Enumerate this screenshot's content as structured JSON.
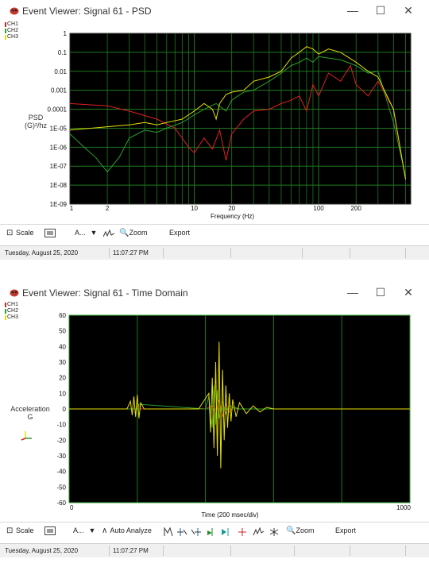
{
  "psd_window": {
    "title": "Event Viewer: Signal  61  - PSD",
    "controls": {
      "minimize": "—",
      "maximize": "☐",
      "close": "✕"
    },
    "legend": [
      {
        "label": "CH1",
        "color": "#e02020"
      },
      {
        "label": "CH2",
        "color": "#2aa02a"
      },
      {
        "label": "CH3",
        "color": "#e8e000"
      }
    ],
    "ylabel_line1": "PSD",
    "ylabel_line2": "(G)²/hz",
    "xlabel": "Frequency (Hz)",
    "toolbar": {
      "scale": "Scale",
      "a_menu": "A...",
      "zoom": "Zoom",
      "export": "Export"
    },
    "status": {
      "date": "Tuesday, August 25, 2020",
      "time": "11:07:27 PM"
    }
  },
  "time_window": {
    "title": "Event Viewer: Signal  61  - Time Domain",
    "controls": {
      "minimize": "—",
      "maximize": "☐",
      "close": "✕"
    },
    "legend": [
      {
        "label": "CH1",
        "color": "#e02020"
      },
      {
        "label": "CH2",
        "color": "#2aa02a"
      },
      {
        "label": "CH3",
        "color": "#e8e000"
      }
    ],
    "ylabel_line1": "Acceleration",
    "ylabel_line2": "G",
    "xlabel": "Time (200 msec/div)",
    "toolbar": {
      "scale": "Scale",
      "a_menu": "A...",
      "auto_analyze": "Auto Analyze",
      "zoom": "Zoom",
      "export": "Export"
    },
    "status": {
      "date": "Tuesday, August 25, 2020",
      "time": "11:07:27 PM"
    }
  },
  "chart_data": [
    {
      "type": "line",
      "xlabel": "Frequency (Hz)",
      "ylabel": "PSD (G)²/hz",
      "x_scale": "log",
      "y_scale": "log",
      "xlim": [
        1,
        550
      ],
      "ylim": [
        1e-09,
        1
      ],
      "grid": true,
      "legend_position": "top-left",
      "x_tick_labels": [
        "1",
        "2",
        "10",
        "20",
        "100",
        "200"
      ],
      "y_tick_labels": [
        "1E-09",
        "1E-08",
        "1E-07",
        "1E-06",
        "1E-05",
        "0.0001",
        "0.001",
        "0.01",
        "0.1",
        "1"
      ],
      "series": [
        {
          "name": "CH1",
          "color": "#e02020",
          "x": [
            1,
            2,
            3,
            5,
            7,
            9,
            10,
            12,
            14,
            16,
            18,
            20,
            25,
            30,
            40,
            50,
            60,
            70,
            80,
            90,
            100,
            120,
            150,
            180,
            200,
            250,
            300,
            400,
            500
          ],
          "y": [
            0.0002,
            0.00015,
            8e-05,
            3e-05,
            1e-05,
            1e-06,
            5e-07,
            3e-06,
            8e-07,
            8e-06,
            2e-07,
            5e-06,
            3e-05,
            8e-05,
            0.0001,
            0.0002,
            0.0003,
            0.0005,
            8e-05,
            0.002,
            0.0005,
            0.008,
            0.003,
            0.02,
            0.002,
            0.0005,
            0.003,
            0.0001,
            2e-08
          ]
        },
        {
          "name": "CH2",
          "color": "#2aa02a",
          "x": [
            1,
            1.3,
            1.6,
            2,
            2.5,
            3,
            4,
            5,
            6,
            8,
            10,
            12,
            15,
            18,
            20,
            25,
            30,
            40,
            50,
            60,
            70,
            80,
            90,
            100,
            120,
            150,
            200,
            250,
            300,
            400,
            500
          ],
          "y": [
            5e-06,
            1e-06,
            3e-07,
            5e-08,
            3e-07,
            3e-06,
            8e-06,
            6e-06,
            1e-05,
            2e-05,
            5e-05,
            0.0001,
            0.0002,
            8e-05,
            0.0003,
            0.0008,
            0.001,
            0.003,
            0.008,
            0.02,
            0.03,
            0.05,
            0.03,
            0.06,
            0.05,
            0.04,
            0.02,
            0.008,
            0.01,
            2e-05,
            3e-08
          ]
        },
        {
          "name": "CH3",
          "color": "#e8e000",
          "x": [
            1,
            1.5,
            2,
            3,
            4,
            5,
            6,
            8,
            10,
            12,
            14,
            15,
            16,
            18,
            20,
            25,
            30,
            40,
            50,
            60,
            70,
            80,
            90,
            100,
            120,
            150,
            200,
            250,
            300,
            400,
            500
          ],
          "y": [
            8e-06,
            1e-05,
            1.2e-05,
            1.5e-05,
            2e-05,
            1.5e-05,
            2e-05,
            3e-05,
            8e-05,
            0.0002,
            0.0001,
            3e-05,
            0.0002,
            0.0006,
            0.0008,
            0.001,
            0.003,
            0.005,
            0.01,
            0.05,
            0.1,
            0.2,
            0.15,
            0.08,
            0.15,
            0.1,
            0.03,
            0.01,
            0.005,
            0.0001,
            2e-08
          ]
        }
      ]
    },
    {
      "type": "line",
      "xlabel": "Time (200 msec/div)",
      "ylabel": "Acceleration G",
      "xlim": [
        0,
        1000
      ],
      "ylim": [
        -60,
        60
      ],
      "grid": true,
      "legend_position": "top-left",
      "x_tick_labels": [
        "0",
        "1000"
      ],
      "y_tick_labels": [
        "60",
        "50",
        "40",
        "30",
        "20",
        "10",
        "0",
        "-10",
        "-20",
        "-30",
        "-40",
        "-50",
        "-60"
      ],
      "series": [
        {
          "name": "CH1",
          "color": "#e02020",
          "x": [
            0,
            200,
            205,
            210,
            400,
            420,
            430,
            440,
            450,
            460,
            470,
            480,
            500,
            600,
            1000
          ],
          "y": [
            0,
            0,
            2,
            0,
            0,
            2,
            -4,
            6,
            -5,
            3,
            -2,
            1,
            0,
            0,
            0
          ]
        },
        {
          "name": "CH2",
          "color": "#2aa02a",
          "x": [
            0,
            200,
            205,
            400,
            410,
            420,
            425,
            430,
            435,
            440,
            450,
            460,
            470,
            500,
            600,
            1000
          ],
          "y": [
            0,
            0,
            3,
            0,
            8,
            -12,
            15,
            -10,
            12,
            -6,
            5,
            -3,
            2,
            0,
            0,
            0
          ]
        },
        {
          "name": "CH3",
          "color": "#e8e000",
          "x": [
            0,
            170,
            180,
            185,
            190,
            195,
            200,
            205,
            210,
            220,
            380,
            410,
            415,
            420,
            425,
            430,
            435,
            440,
            445,
            450,
            455,
            460,
            465,
            470,
            475,
            480,
            490,
            500,
            520,
            540,
            560,
            580,
            600,
            700,
            1000
          ],
          "y": [
            0,
            0,
            5,
            -4,
            8,
            -5,
            9,
            -6,
            4,
            0,
            0,
            10,
            -15,
            20,
            -25,
            30,
            -30,
            43,
            -38,
            25,
            -20,
            15,
            -12,
            10,
            -8,
            6,
            -5,
            4,
            -3,
            2,
            -2,
            1,
            0,
            0,
            0
          ]
        }
      ]
    }
  ]
}
